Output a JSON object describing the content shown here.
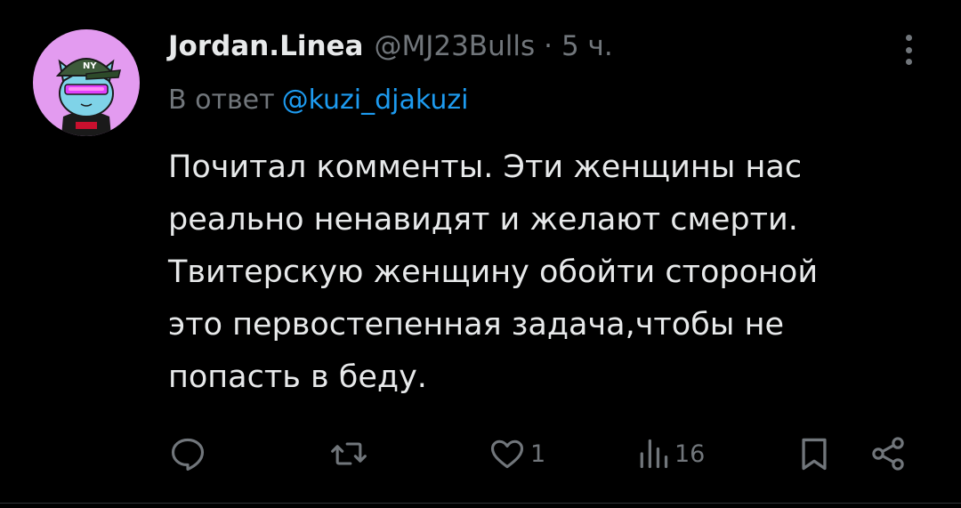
{
  "tweet": {
    "display_name": "Jordan.Linea",
    "handle": "@MJ23Bulls",
    "separator": "·",
    "time": "5 ч.",
    "reply_prefix": "В ответ",
    "reply_handle": "@kuzi_djakuzi",
    "body_lines": [
      "Почитал комменты. Эти женщины нас",
      "реально ненавидят и желают смерти.",
      "Твитерскую женщину обойти стороной",
      "это первостепенная задача,чтобы не",
      "попасть в беду."
    ]
  },
  "actions": {
    "reply": {
      "icon": "comment-icon"
    },
    "retweet": {
      "icon": "retweet-icon"
    },
    "like": {
      "icon": "heart-icon",
      "count": "1"
    },
    "views": {
      "icon": "views-icon",
      "count": "16"
    },
    "bookmark": {
      "icon": "bookmark-icon"
    },
    "share": {
      "icon": "share-icon"
    }
  },
  "colors": {
    "background": "#000000",
    "text_primary": "#e7e9ea",
    "text_secondary": "#71767b",
    "accent": "#1d9bf0",
    "avatar_bg": "#e39bf0"
  }
}
